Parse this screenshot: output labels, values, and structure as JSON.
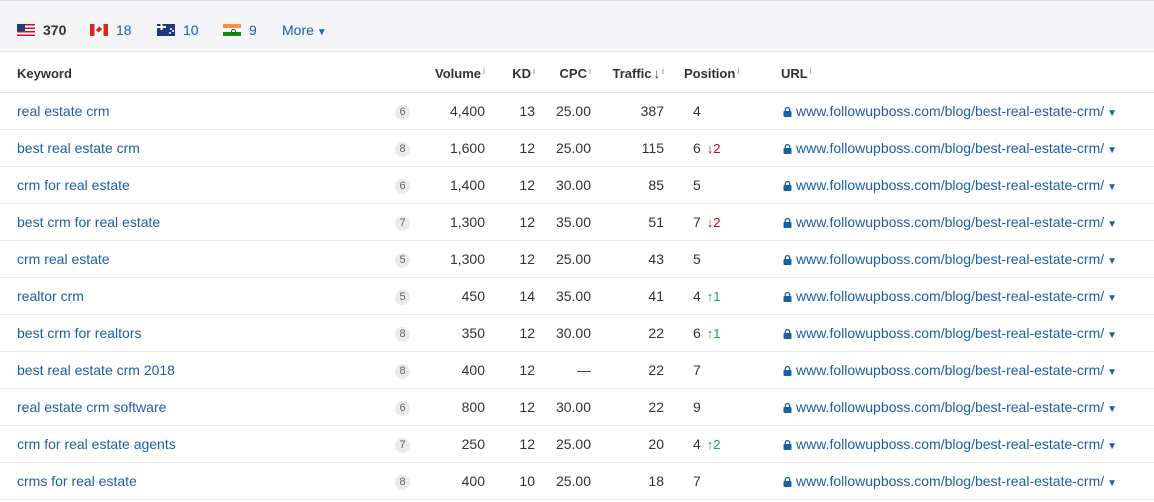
{
  "countries": [
    {
      "flag": "us-flag-icon",
      "count": "370"
    },
    {
      "flag": "ca-flag-icon",
      "count": "18"
    },
    {
      "flag": "au-flag-icon",
      "count": "10"
    },
    {
      "flag": "in-flag-icon",
      "count": "9"
    }
  ],
  "more_label": "More",
  "headers": {
    "keyword": "Keyword",
    "volume": "Volume",
    "kd": "KD",
    "cpc": "CPC",
    "traffic": "Traffic",
    "position": "Position",
    "url": "URL",
    "info": "i",
    "sort_arrow": "↓"
  },
  "rows": [
    {
      "keyword": "real estate crm",
      "serp": "6",
      "volume": "4,400",
      "kd": "13",
      "cpc": "25.00",
      "traffic": "387",
      "position": "4",
      "change": "",
      "direction": "",
      "url": "www.followupboss.com/blog/best-real-estate-crm/"
    },
    {
      "keyword": "best real estate crm",
      "serp": "8",
      "volume": "1,600",
      "kd": "12",
      "cpc": "25.00",
      "traffic": "115",
      "position": "6",
      "change": "↓2",
      "direction": "down",
      "url": "www.followupboss.com/blog/best-real-estate-crm/"
    },
    {
      "keyword": "crm for real estate",
      "serp": "6",
      "volume": "1,400",
      "kd": "12",
      "cpc": "30.00",
      "traffic": "85",
      "position": "5",
      "change": "",
      "direction": "",
      "url": "www.followupboss.com/blog/best-real-estate-crm/"
    },
    {
      "keyword": "best crm for real estate",
      "serp": "7",
      "volume": "1,300",
      "kd": "12",
      "cpc": "35.00",
      "traffic": "51",
      "position": "7",
      "change": "↓2",
      "direction": "down",
      "url": "www.followupboss.com/blog/best-real-estate-crm/"
    },
    {
      "keyword": "crm real estate",
      "serp": "5",
      "volume": "1,300",
      "kd": "12",
      "cpc": "25.00",
      "traffic": "43",
      "position": "5",
      "change": "",
      "direction": "",
      "url": "www.followupboss.com/blog/best-real-estate-crm/"
    },
    {
      "keyword": "realtor crm",
      "serp": "5",
      "volume": "450",
      "kd": "14",
      "cpc": "35.00",
      "traffic": "41",
      "position": "4",
      "change": "↑1",
      "direction": "up",
      "url": "www.followupboss.com/blog/best-real-estate-crm/"
    },
    {
      "keyword": "best crm for realtors",
      "serp": "8",
      "volume": "350",
      "kd": "12",
      "cpc": "30.00",
      "traffic": "22",
      "position": "6",
      "change": "↑1",
      "direction": "up",
      "url": "www.followupboss.com/blog/best-real-estate-crm/"
    },
    {
      "keyword": "best real estate crm 2018",
      "serp": "8",
      "volume": "400",
      "kd": "12",
      "cpc": "—",
      "traffic": "22",
      "position": "7",
      "change": "",
      "direction": "",
      "url": "www.followupboss.com/blog/best-real-estate-crm/"
    },
    {
      "keyword": "real estate crm software",
      "serp": "6",
      "volume": "800",
      "kd": "12",
      "cpc": "30.00",
      "traffic": "22",
      "position": "9",
      "change": "",
      "direction": "",
      "url": "www.followupboss.com/blog/best-real-estate-crm/"
    },
    {
      "keyword": "crm for real estate agents",
      "serp": "7",
      "volume": "250",
      "kd": "12",
      "cpc": "25.00",
      "traffic": "20",
      "position": "4",
      "change": "↑2",
      "direction": "up",
      "url": "www.followupboss.com/blog/best-real-estate-crm/"
    },
    {
      "keyword": "crms for real estate",
      "serp": "8",
      "volume": "400",
      "kd": "10",
      "cpc": "25.00",
      "traffic": "18",
      "position": "7",
      "change": "",
      "direction": "",
      "url": "www.followupboss.com/blog/best-real-estate-crm/"
    }
  ],
  "colors": {
    "link": "#1a5fa8",
    "down": "#d0021b",
    "up": "#16a34a",
    "bar_bg": "#f4f4f6"
  }
}
